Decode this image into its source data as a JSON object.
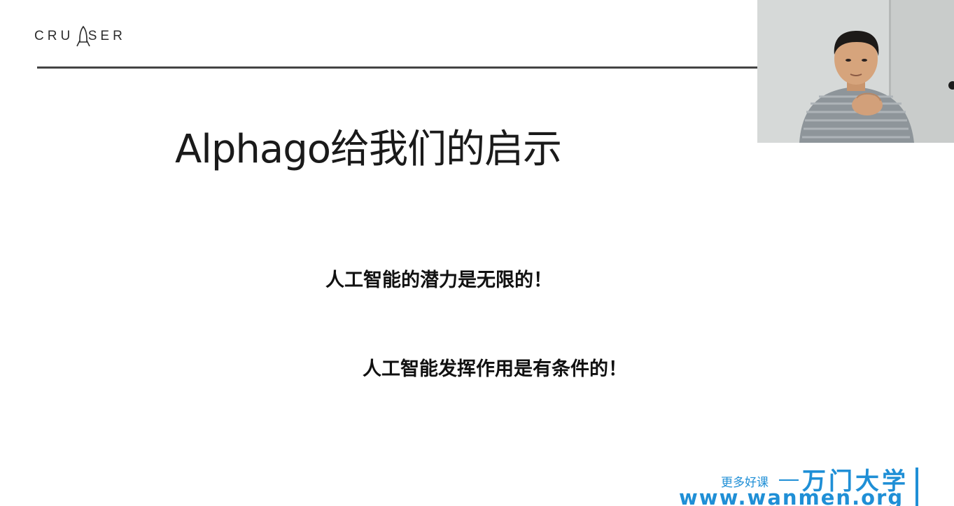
{
  "slide": {
    "logo_text": "CRU  SER",
    "title": "Alphago给我们的启示",
    "points": [
      "人工智能的潜力是无限的！",
      "人工智能发挥作用是有条件的！"
    ]
  },
  "watermark": {
    "tagline": "更多好课",
    "brand": "万门大学",
    "url": "www.wanmen.org"
  },
  "colors": {
    "accent": "#1f8fd6",
    "rule": "#444444",
    "text": "#111111"
  },
  "icons": {
    "logo": "rocket-icon",
    "webcam": "presenter-video-feed"
  }
}
